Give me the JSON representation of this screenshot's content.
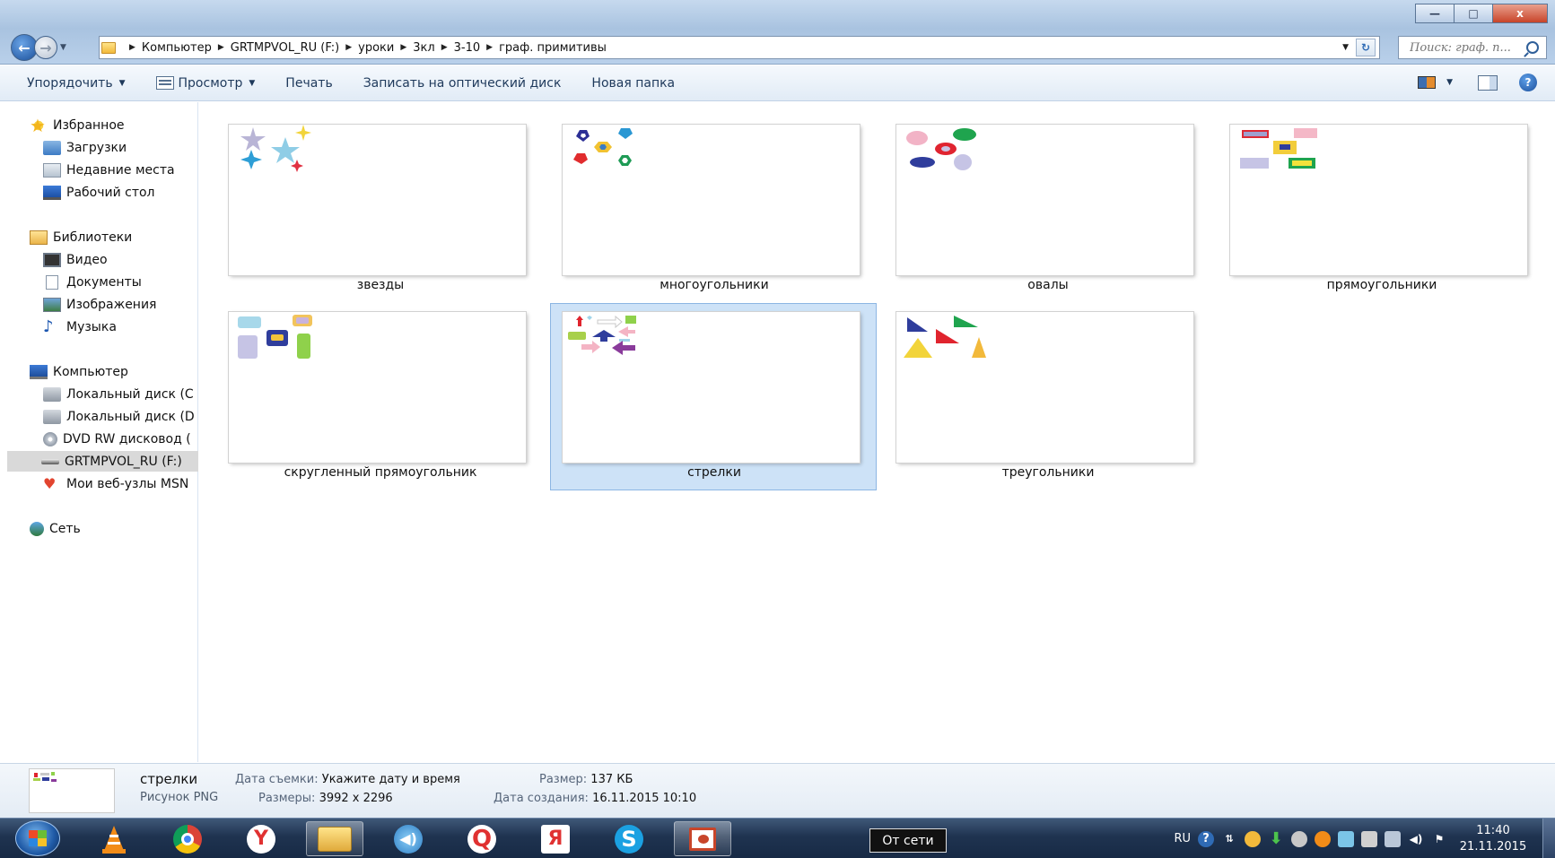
{
  "window": {
    "minimize_glyph": "—",
    "maximize_glyph": "□",
    "close_glyph": "x"
  },
  "address": {
    "breadcrumbs": [
      "Компьютер",
      "GRTMPVOL_RU (F:)",
      "уроки",
      "3кл",
      "3-10",
      "граф. примитивы"
    ],
    "search_placeholder": "Поиск: граф. п..."
  },
  "toolbar": {
    "organize": "Упорядочить",
    "view": "Просмотр",
    "print": "Печать",
    "burn": "Записать на оптический диск",
    "new_folder": "Новая папка"
  },
  "navpane": {
    "favorites": "Избранное",
    "downloads": "Загрузки",
    "recent": "Недавние места",
    "desktop": "Рабочий стол",
    "libraries": "Библиотеки",
    "video": "Видео",
    "documents": "Документы",
    "images": "Изображения",
    "music": "Музыка",
    "computer": "Компьютер",
    "disk_c": "Локальный диск (C",
    "disk_d": "Локальный диск (D",
    "dvd": "DVD RW дисковод (",
    "usb": "GRTMPVOL_RU (F:)",
    "msn": "Мои веб-узлы MSN",
    "network": "Сеть"
  },
  "files": [
    {
      "name": "звезды"
    },
    {
      "name": "многоугольники"
    },
    {
      "name": "овалы"
    },
    {
      "name": "прямоугольники"
    },
    {
      "name": "скругленный прямоугольник"
    },
    {
      "name": "стрелки",
      "selected": true
    },
    {
      "name": "треугольники"
    }
  ],
  "details": {
    "name": "стрелки",
    "type": "Рисунок PNG",
    "date_taken_label": "Дата съемки:",
    "date_taken_value": "Укажите дату и время",
    "dimensions_label": "Размеры:",
    "dimensions_value": "3992 x 2296",
    "size_label": "Размер:",
    "size_value": "137 КБ",
    "created_label": "Дата создания:",
    "created_value": "16.11.2015 10:10"
  },
  "taskbar": {
    "tooltip": "От сети",
    "lang": "RU",
    "time": "11:40",
    "date": "21.11.2015",
    "apps": [
      {
        "icon": "vlc-icon"
      },
      {
        "icon": "chrome-icon"
      },
      {
        "icon": "yandex-browser-icon",
        "glyph": "Y"
      },
      {
        "icon": "explorer-icon",
        "active": true
      },
      {
        "icon": "audio-icon"
      },
      {
        "icon": "search-q-icon",
        "glyph": "Q"
      },
      {
        "icon": "yandex-icon",
        "glyph": "Я"
      },
      {
        "icon": "skype-icon",
        "glyph": "S"
      },
      {
        "icon": "powerpoint-icon"
      }
    ]
  },
  "colors": {
    "selection": "#cde2f7",
    "toolbar_text": "#1e395b",
    "taskbar": "#1f3350"
  }
}
